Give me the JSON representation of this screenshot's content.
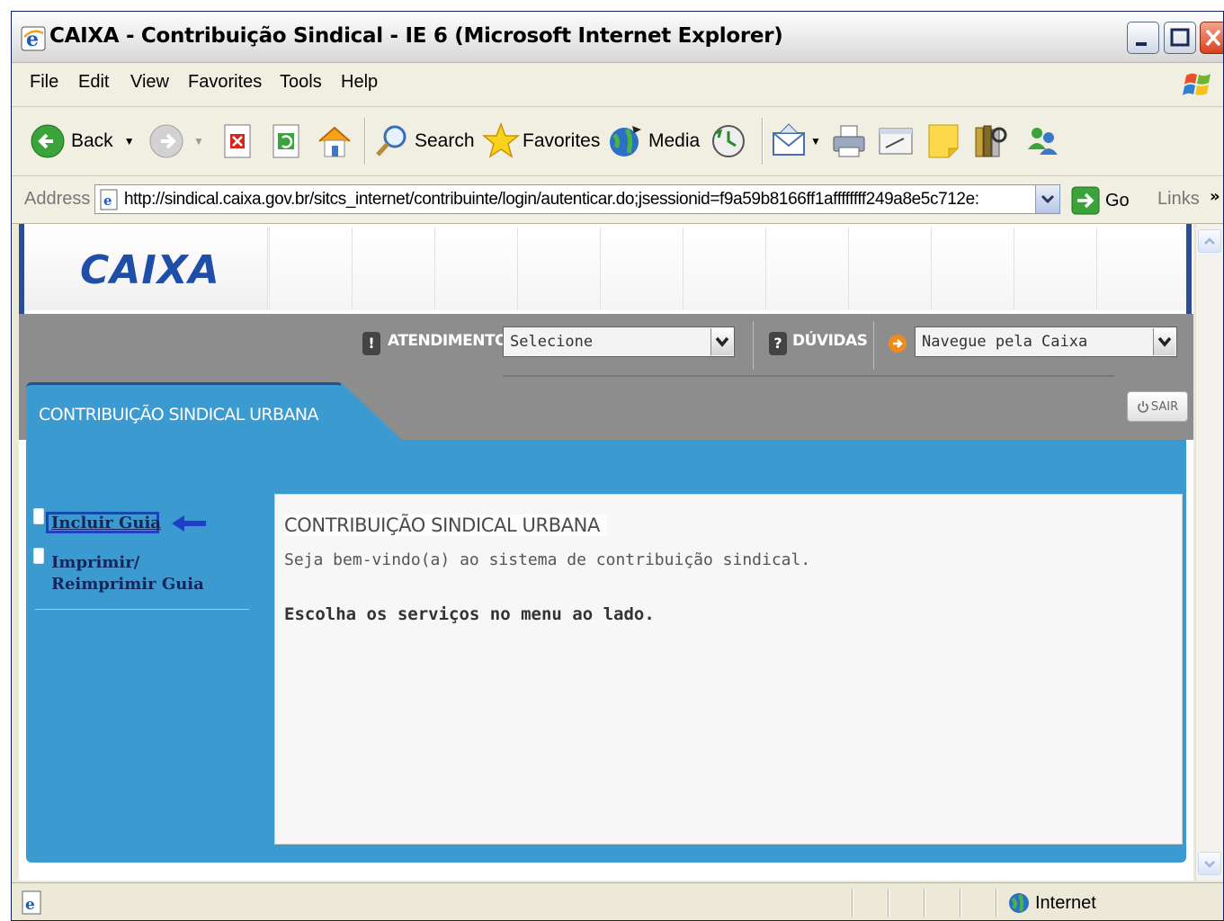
{
  "window": {
    "title": "CAIXA - Contribuição Sindical - IE 6 (Microsoft Internet Explorer)"
  },
  "menubar": {
    "items": [
      "File",
      "Edit",
      "View",
      "Favorites",
      "Tools",
      "Help"
    ]
  },
  "toolbar": {
    "back_label": "Back",
    "search_label": "Search",
    "favorites_label": "Favorites",
    "media_label": "Media"
  },
  "addressbar": {
    "label": "Address",
    "url": "http://sindical.caixa.gov.br/sitcs_internet/contribuinte/login/autenticar.do;jsessionid=f9a59b8166ff1affffffff249a8e5c712e:",
    "go_label": "Go",
    "links_label": "Links"
  },
  "site": {
    "logo": "CAIXA",
    "atendimento_label": "ATENDIMENTO",
    "atendimento_select": "Selecione",
    "duvidas_label": "DÚVIDAS",
    "navegue_select": "Navegue pela Caixa",
    "tab_title": "CONTRIBUIÇÃO SINDICAL URBANA",
    "sair_label": "SAIR"
  },
  "sidemenu": {
    "items": [
      {
        "line1": "Incluir Guia",
        "line2": ""
      },
      {
        "line1": "Imprimir/",
        "line2": "Reimprimir Guia"
      }
    ]
  },
  "panel": {
    "title": "CONTRIBUIÇÃO SINDICAL URBANA",
    "welcome": "Seja bem-vindo(a) ao sistema de contribuição sindical.",
    "instruction": "Escolha os serviços no menu ao lado."
  },
  "statusbar": {
    "zone": "Internet"
  },
  "colors": {
    "caixa_blue": "#3b9ad0",
    "dark_blue": "#2a4d94",
    "highlight_box": "#1f3fc4"
  }
}
